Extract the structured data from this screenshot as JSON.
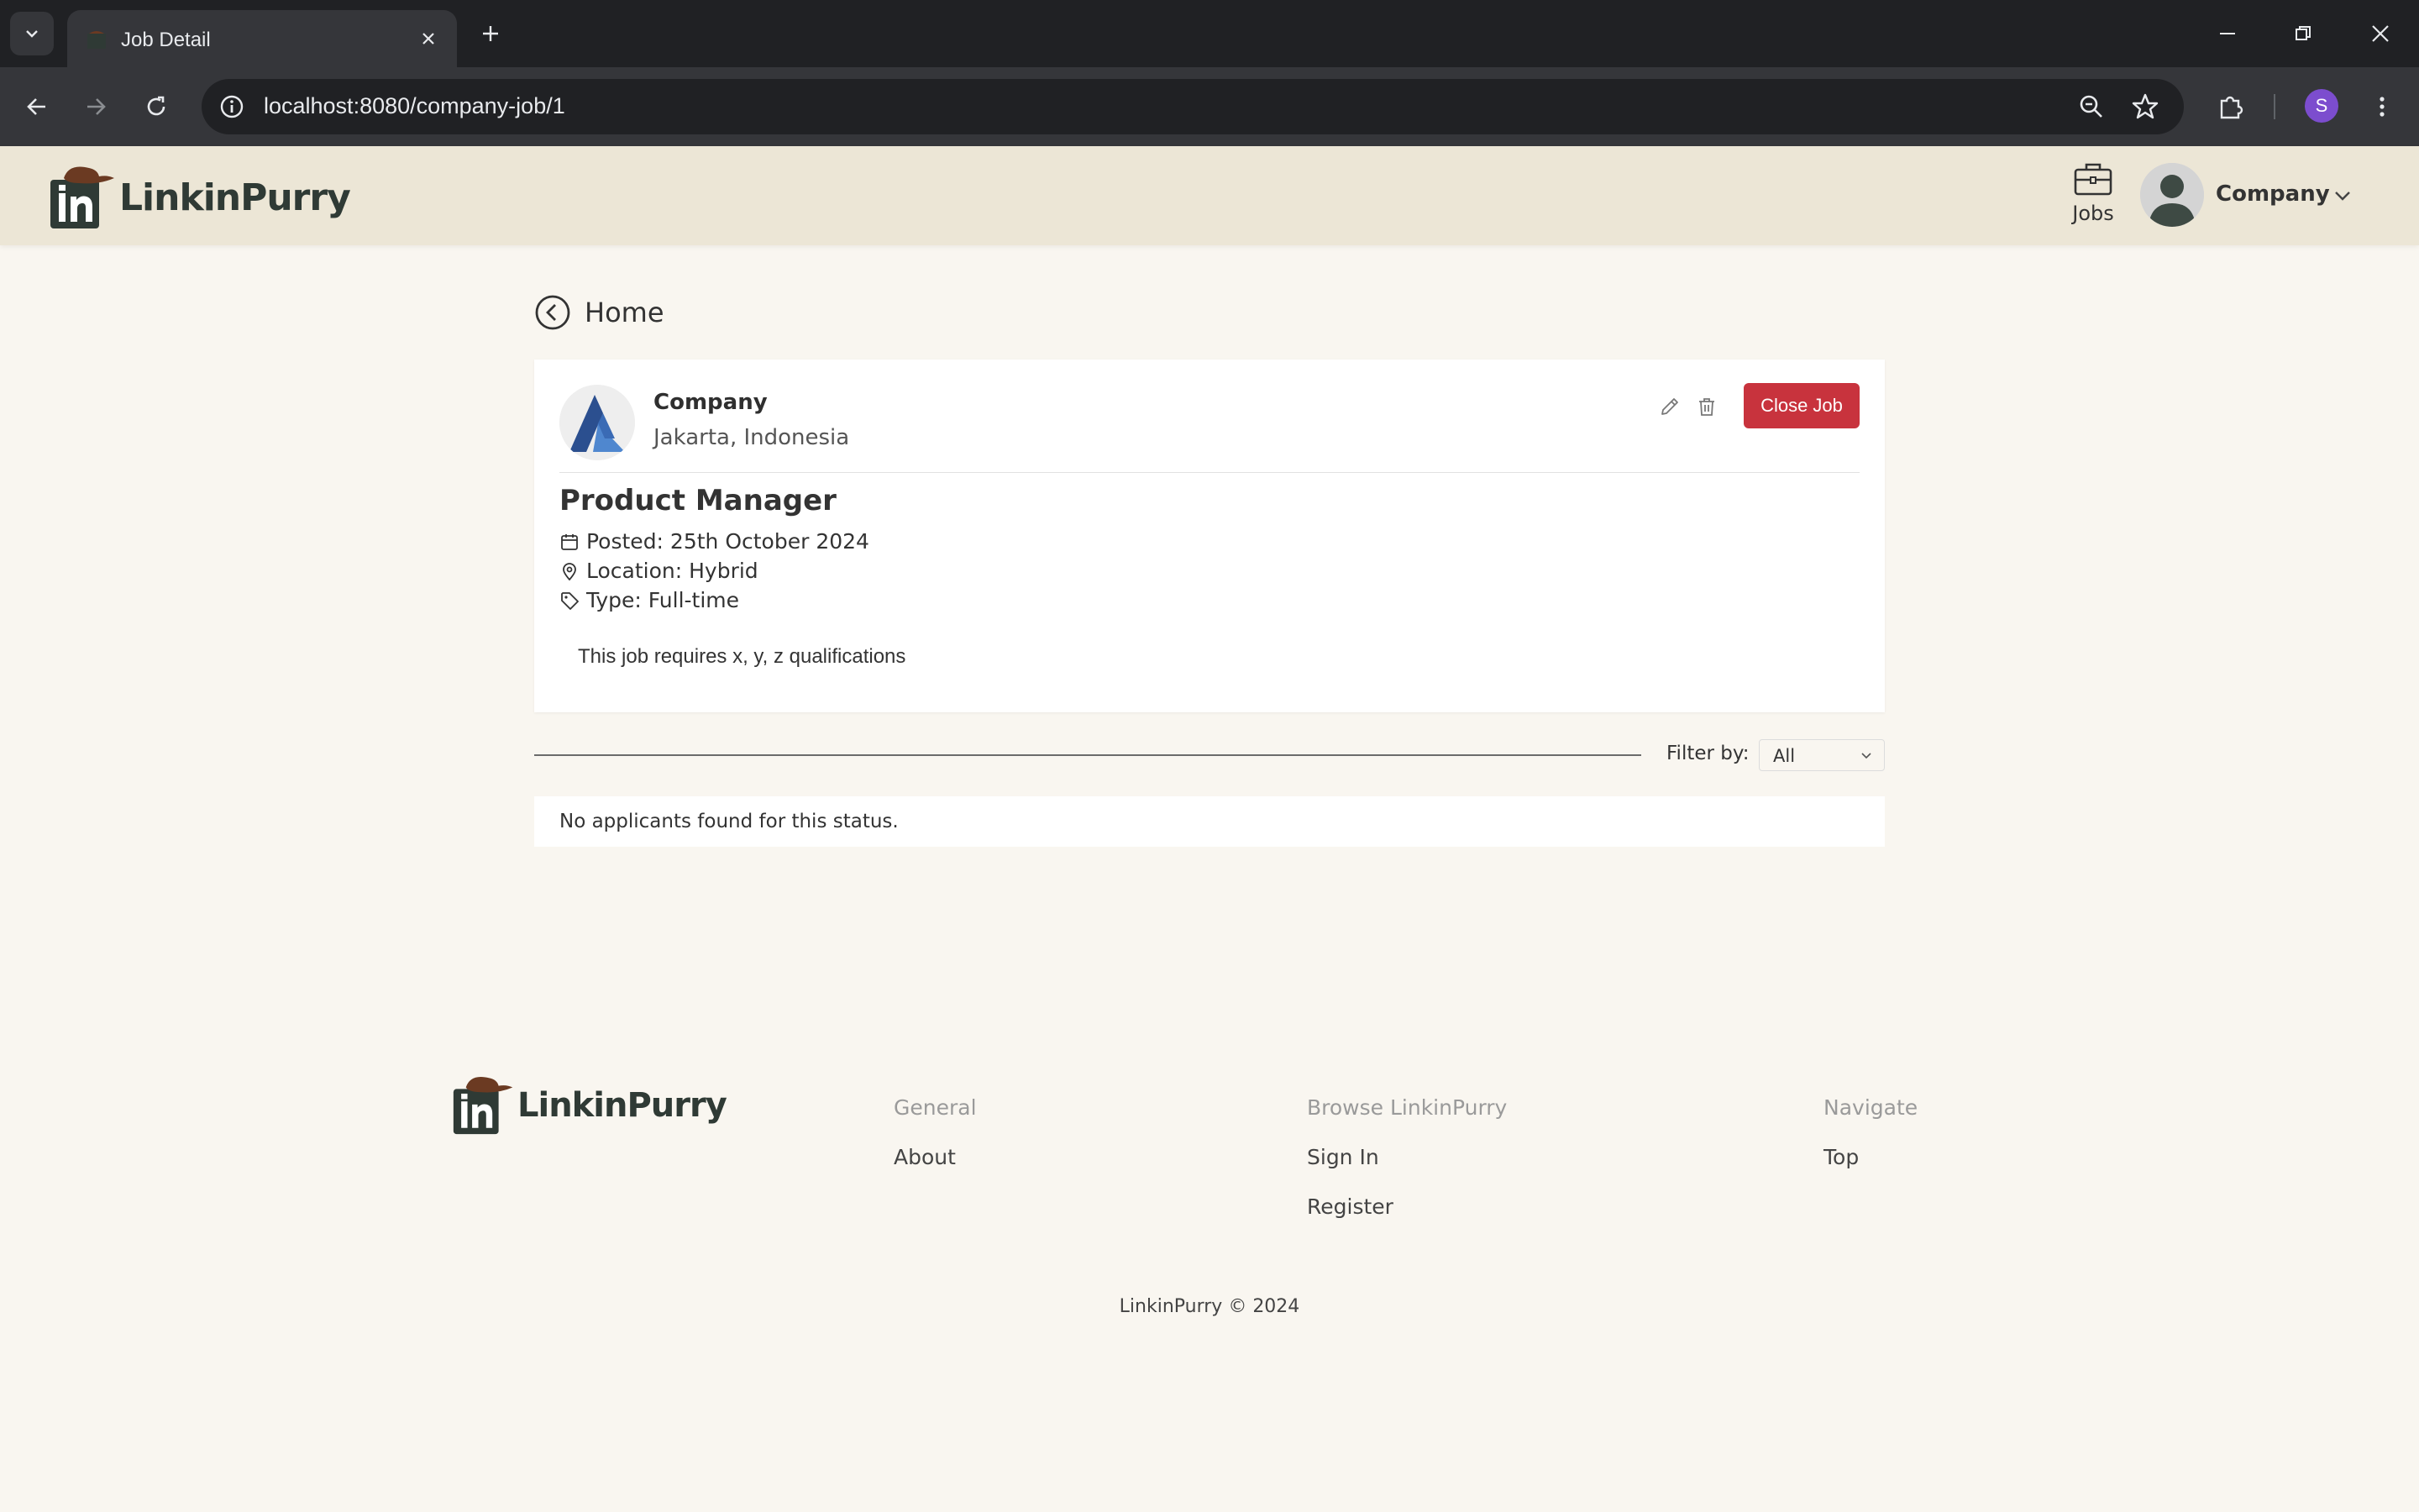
{
  "browser": {
    "tab_title": "Job Detail",
    "url": "localhost:8080/company-job/1",
    "profile_initial": "S"
  },
  "header": {
    "logo_text": "LinkinPurry",
    "logo_mark": "in",
    "nav_jobs_label": "Jobs",
    "user_name": "Company"
  },
  "main": {
    "back_label": "Home",
    "company": {
      "name": "Company",
      "location": "Jakarta, Indonesia"
    },
    "close_job_label": "Close Job",
    "job": {
      "title": "Product Manager",
      "posted": "Posted: 25th October 2024",
      "location": "Location: Hybrid",
      "type": "Type: Full-time",
      "description": "This job requires x, y, z qualifications"
    },
    "filter": {
      "label": "Filter by:",
      "value": "All"
    },
    "empty_message": "No applicants found for this status."
  },
  "footer": {
    "logo_text": "LinkinPurry",
    "logo_mark": "in",
    "columns": [
      {
        "heading": "General",
        "links": [
          "About"
        ]
      },
      {
        "heading": "Browse LinkinPurry",
        "links": [
          "Sign In",
          "Register"
        ]
      },
      {
        "heading": "Navigate",
        "links": [
          "Top"
        ]
      }
    ],
    "copyright": "LinkinPurry © 2024"
  },
  "colors": {
    "page_bg": "#f9f6f0",
    "header_bg": "#ece6d6",
    "logo_green": "#2f3a35",
    "danger": "#c8333d",
    "hat_brown": "#6b3a22"
  }
}
